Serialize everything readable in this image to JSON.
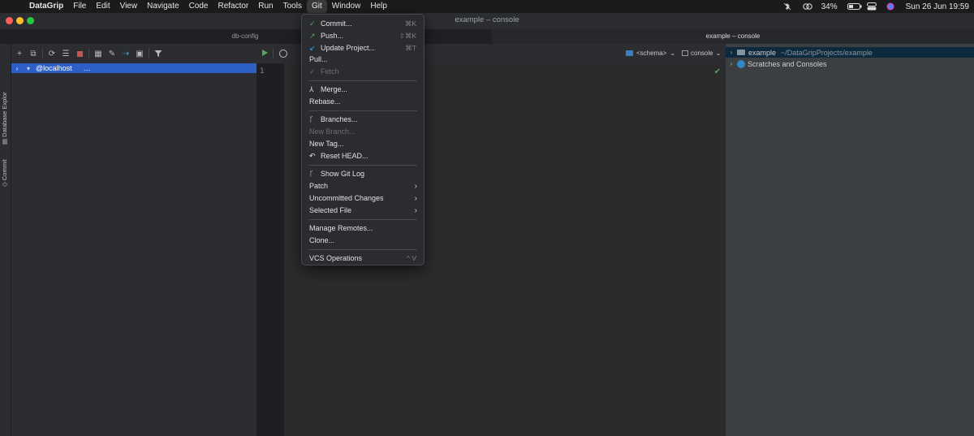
{
  "menubar": {
    "app_name": "DataGrip",
    "items": [
      "File",
      "Edit",
      "View",
      "Navigate",
      "Code",
      "Refactor",
      "Run",
      "Tools",
      "Git",
      "Window",
      "Help"
    ],
    "battery": "34%",
    "datetime": "Sun 26 Jun  19:59"
  },
  "window": {
    "title": "example – console"
  },
  "tabs": {
    "db_config": "db-config",
    "console": "example – console"
  },
  "stripe": {
    "database_explorer": "Database Explor",
    "commit": "Commit"
  },
  "db_explorer": {
    "host": "@localhost",
    "ellipsis": "…"
  },
  "editor": {
    "line_number": "1",
    "schema": "<schema>",
    "console": "console"
  },
  "project": {
    "root_name": "example",
    "root_path": "~/DataGripProjects/example",
    "scratches": "Scratches and Consoles"
  },
  "git_menu": {
    "commit": "Commit...",
    "commit_shortcut": "⌘K",
    "push": "Push...",
    "push_shortcut": "⇧⌘K",
    "update_project": "Update Project...",
    "update_shortcut": "⌘T",
    "pull": "Pull...",
    "fetch": "Fetch",
    "merge": "Merge...",
    "rebase": "Rebase...",
    "branches": "Branches...",
    "new_branch": "New Branch...",
    "new_tag": "New Tag...",
    "reset_head": "Reset HEAD...",
    "show_git_log": "Show Git Log",
    "patch": "Patch",
    "uncommitted_changes": "Uncommitted Changes",
    "selected_file": "Selected File",
    "manage_remotes": "Manage Remotes...",
    "clone": "Clone...",
    "vcs_operations": "VCS Operations",
    "vcs_shortcut": "^ V"
  },
  "colors": {
    "accent_selection": "#2e5fc7",
    "run_green": "#57a65b",
    "menu_background": "#2b2c30"
  },
  "icons": [
    "apple-icon",
    "check-icon",
    "push-arrow-icon",
    "update-arrow-icon",
    "merge-icon",
    "branch-icon",
    "undo-icon",
    "submenu-chevron-icon",
    "folder-icon",
    "scratches-icon"
  ]
}
